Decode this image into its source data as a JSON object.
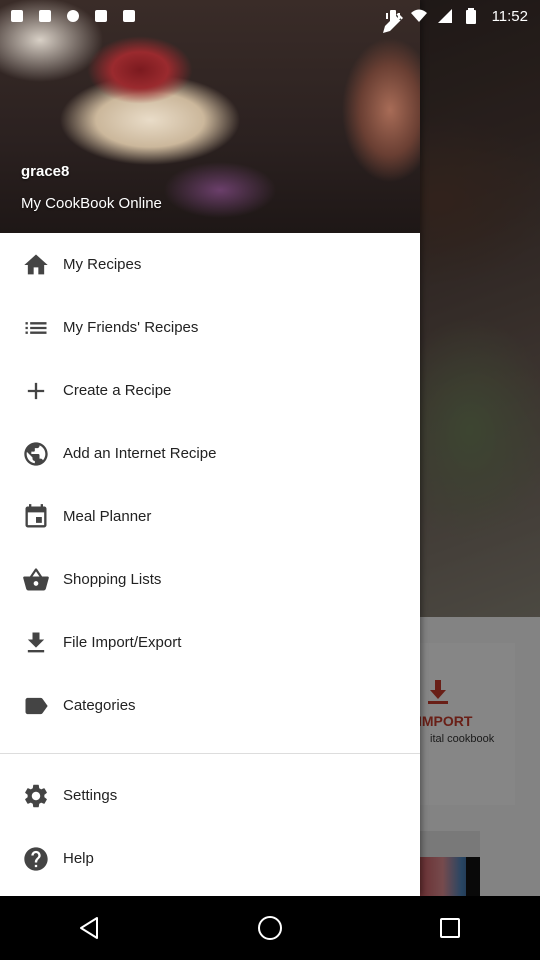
{
  "status_bar": {
    "time": "11:52",
    "icons": [
      "notification-icon",
      "notification-icon",
      "notification-icon",
      "notification-icon",
      "notification-icon",
      "vibrate-icon",
      "wifi-icon",
      "signal-icon",
      "battery-icon"
    ]
  },
  "drawer": {
    "header": {
      "username": "grace8",
      "subtitle": "My CookBook Online",
      "edit_icon": "pencil-icon"
    },
    "items": [
      {
        "label": "My Recipes",
        "icon": "home-icon"
      },
      {
        "label": "My Friends' Recipes",
        "icon": "list-icon"
      },
      {
        "label": "Create a Recipe",
        "icon": "plus-icon"
      },
      {
        "label": "Add an Internet Recipe",
        "icon": "globe-icon"
      },
      {
        "label": "Meal Planner",
        "icon": "calendar-icon"
      },
      {
        "label": "Shopping Lists",
        "icon": "basket-icon"
      },
      {
        "label": "File Import/Export",
        "icon": "download-icon"
      },
      {
        "label": "Categories",
        "icon": "label-icon"
      }
    ],
    "secondary_items": [
      {
        "label": "Settings",
        "icon": "gear-icon"
      },
      {
        "label": "Help",
        "icon": "help-icon"
      }
    ]
  },
  "background": {
    "card_title": "IMPORT",
    "card_subtitle": "ital cookbook"
  },
  "nav_bar": {
    "buttons": [
      "back-icon",
      "home-icon",
      "recents-icon"
    ]
  },
  "colors": {
    "icon": "#444444",
    "text": "#222222",
    "accent": "#c0392b"
  }
}
